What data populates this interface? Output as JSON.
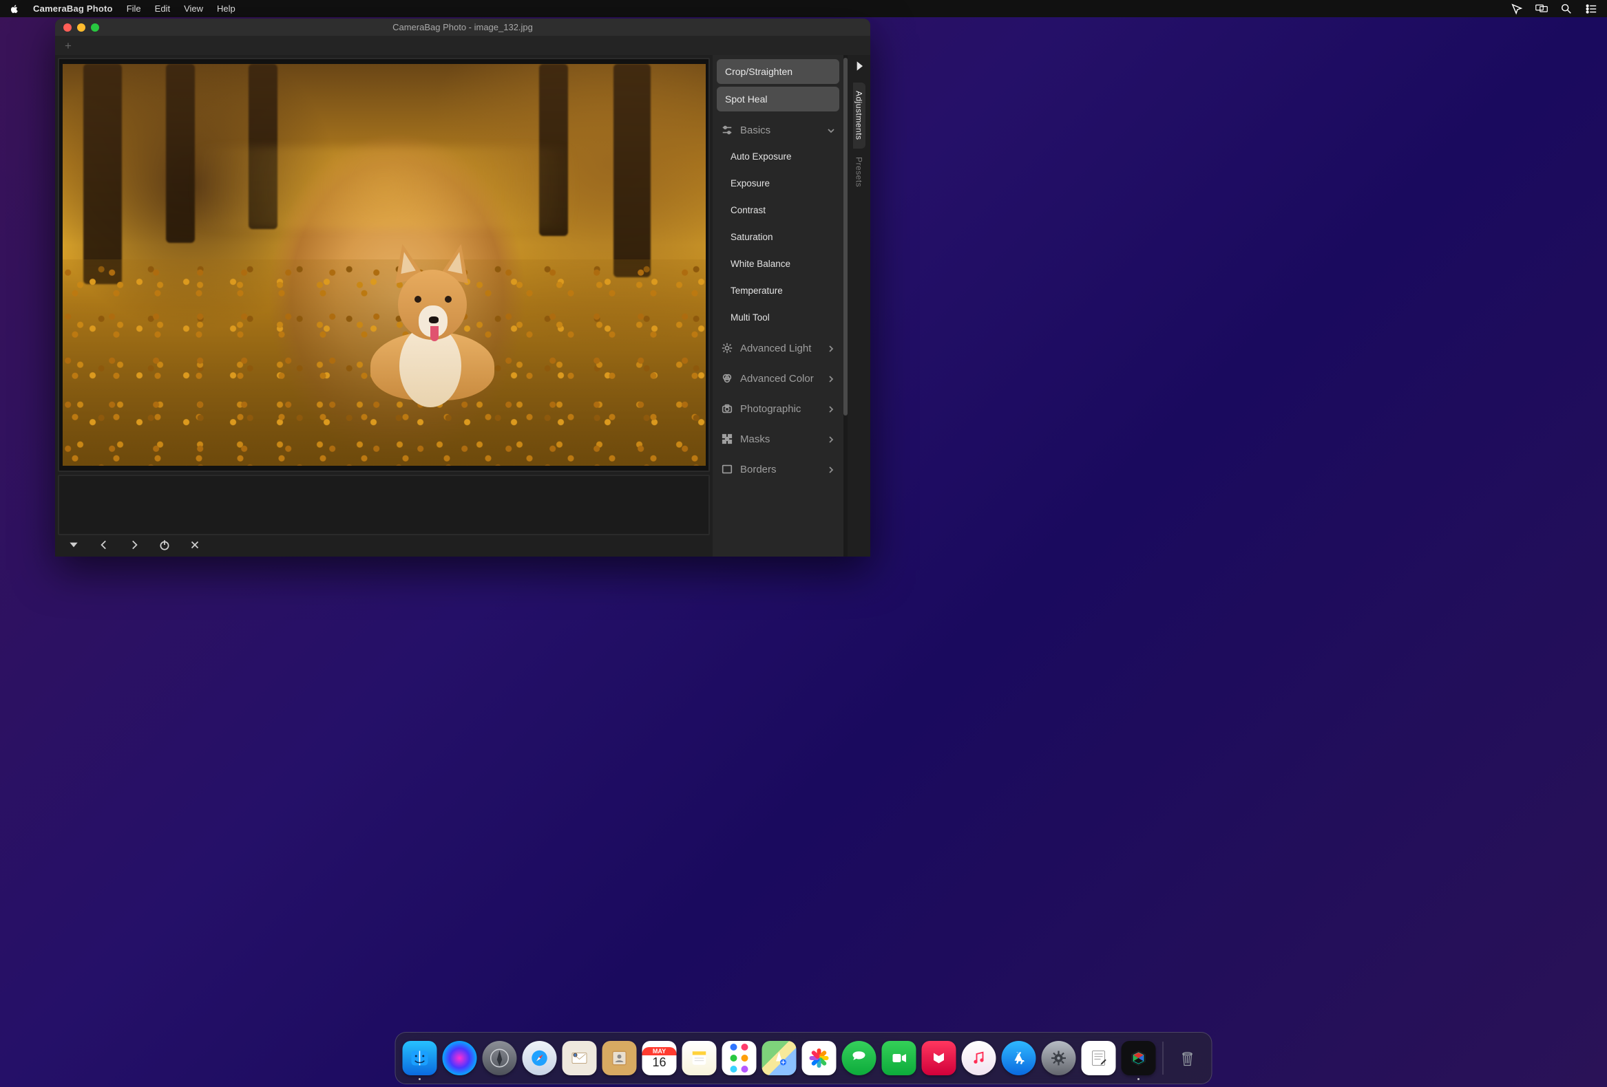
{
  "menubar": {
    "app_name": "CameraBag Photo",
    "items": [
      "File",
      "Edit",
      "View",
      "Help"
    ]
  },
  "window": {
    "title": "CameraBag Photo - image_132.jpg"
  },
  "side_tabs": {
    "adjustments": "Adjustments",
    "presets": "Presets"
  },
  "panel": {
    "crop_btn": "Crop/Straighten",
    "spot_heal_btn": "Spot Heal",
    "basics": {
      "label": "Basics",
      "items": [
        "Auto Exposure",
        "Exposure",
        "Contrast",
        "Saturation",
        "White Balance",
        "Temperature",
        "Multi Tool"
      ]
    },
    "sections": [
      {
        "label": "Advanced Light"
      },
      {
        "label": "Advanced Color"
      },
      {
        "label": "Photographic"
      },
      {
        "label": "Masks"
      },
      {
        "label": "Borders"
      }
    ]
  },
  "dock": {
    "calendar": {
      "month": "MAY",
      "day": "16"
    },
    "labels": {
      "finder": "Finder",
      "siri": "Siri",
      "launchpad": "Launchpad",
      "safari": "Safari",
      "mail": "Mail",
      "contacts": "Contacts",
      "calendar": "Calendar",
      "notes": "Notes",
      "reminders": "Reminders",
      "maps": "Maps",
      "photos": "Photos",
      "messages": "Messages",
      "facetime": "FaceTime",
      "news": "News",
      "music": "Music",
      "appstore": "App Store",
      "settings": "System Preferences",
      "textedit": "TextEdit",
      "camerabag": "CameraBag Photo",
      "trash": "Trash"
    }
  }
}
